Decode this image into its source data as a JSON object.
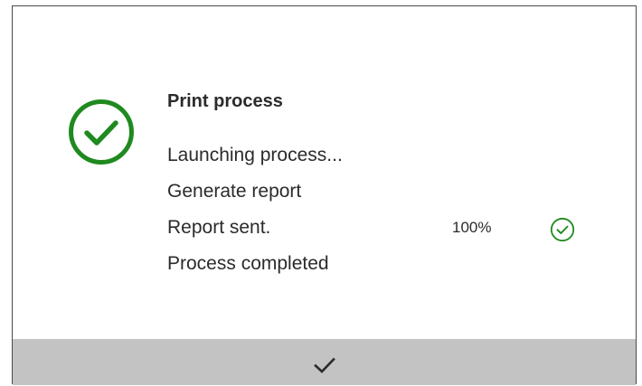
{
  "dialog": {
    "title": "Print process",
    "status_icon": "check-circle-icon",
    "steps": [
      {
        "label": "Launching process..."
      },
      {
        "label": "Generate report"
      },
      {
        "label": "Report sent.",
        "progress": "100%",
        "progress_value": 1.0,
        "status_icon": "check-circle-icon"
      },
      {
        "label": "Process completed"
      }
    ],
    "confirm_icon": "checkmark-icon"
  },
  "colors": {
    "success": "#1f8a1f",
    "footer_bg": "#c3c3c3",
    "text": "#2b2b2b",
    "border": "#4a4a4a"
  }
}
